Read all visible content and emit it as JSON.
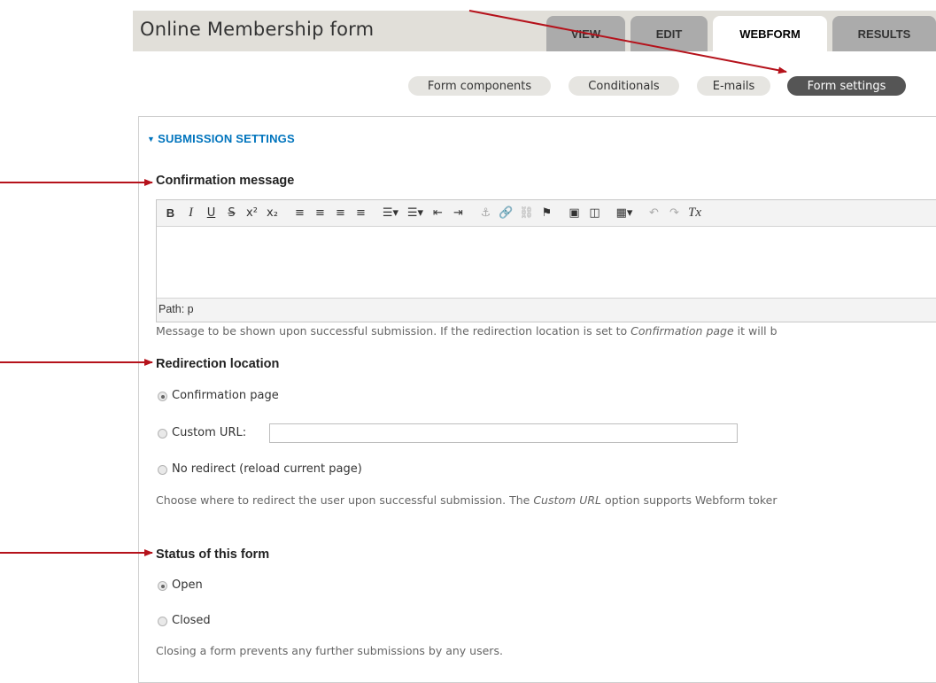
{
  "page": {
    "title": "Online Membership form"
  },
  "primary_tabs": [
    {
      "label": "VIEW",
      "active": false
    },
    {
      "label": "EDIT",
      "active": false
    },
    {
      "label": "WEBFORM",
      "active": true
    },
    {
      "label": "RESULTS",
      "active": false
    }
  ],
  "secondary_tabs": [
    {
      "label": "Form components",
      "active": false
    },
    {
      "label": "Conditionals",
      "active": false
    },
    {
      "label": "E-mails",
      "active": false
    },
    {
      "label": "Form settings",
      "active": true
    }
  ],
  "submission_settings": {
    "legend": "SUBMISSION SETTINGS",
    "confirmation": {
      "label": "Confirmation message",
      "toolbar_icons": [
        "bold-icon",
        "italic-icon",
        "underline-icon",
        "strikethrough-icon",
        "superscript-icon",
        "subscript-icon",
        "align-left-icon",
        "align-center-icon",
        "align-right-icon",
        "align-justify-icon",
        "bulleted-list-icon",
        "numbered-list-icon",
        "outdent-icon",
        "indent-icon",
        "anchor-icon",
        "link-icon",
        "unlink-icon",
        "bookmark-icon",
        "image-icon",
        "media-icon",
        "table-icon",
        "undo-icon",
        "redo-icon",
        "remove-format-icon"
      ],
      "toolbar_glyphs": {
        "bold": "B",
        "italic": "I",
        "underline": "U",
        "strike": "S",
        "superscript": "x²",
        "subscript": "x₂",
        "align_left": "≡",
        "align_center": "≡",
        "align_right": "≡",
        "align_justify": "≡",
        "bullets": "☰▾",
        "numbers": "☰▾",
        "outdent": "⇤",
        "indent": "⇥",
        "anchor": "⚓",
        "link": "🔗",
        "unlink": "⛓",
        "bookmark": "⚑",
        "image": "▣",
        "media": "◫",
        "table": "▦▾",
        "undo": "↶",
        "redo": "↷",
        "clear": "Tx"
      },
      "path": "Path: p",
      "description_before": "Message to be shown upon successful submission. If the redirection location is set to ",
      "description_em": "Confirmation page",
      "description_after": " it will b"
    },
    "redirection": {
      "label": "Redirection location",
      "options": [
        {
          "label": "Confirmation page",
          "checked": true
        },
        {
          "label": "Custom URL:",
          "checked": false
        },
        {
          "label": "No redirect (reload current page)",
          "checked": false
        }
      ],
      "custom_url_value": "",
      "description_before": "Choose where to redirect the user upon successful submission. The ",
      "description_em": "Custom URL",
      "description_after": " option supports Webform toker"
    },
    "status": {
      "label": "Status of this form",
      "options": [
        {
          "label": "Open",
          "checked": true
        },
        {
          "label": "Closed",
          "checked": false
        }
      ],
      "description": "Closing a form prevents any further submissions by any users."
    }
  },
  "colors": {
    "annotation_arrow": "#b5121b",
    "legend_link": "#0074bd",
    "header_bg": "#e1dfd9",
    "tab_inactive": "#ababab",
    "subtab_active": "#555555"
  }
}
